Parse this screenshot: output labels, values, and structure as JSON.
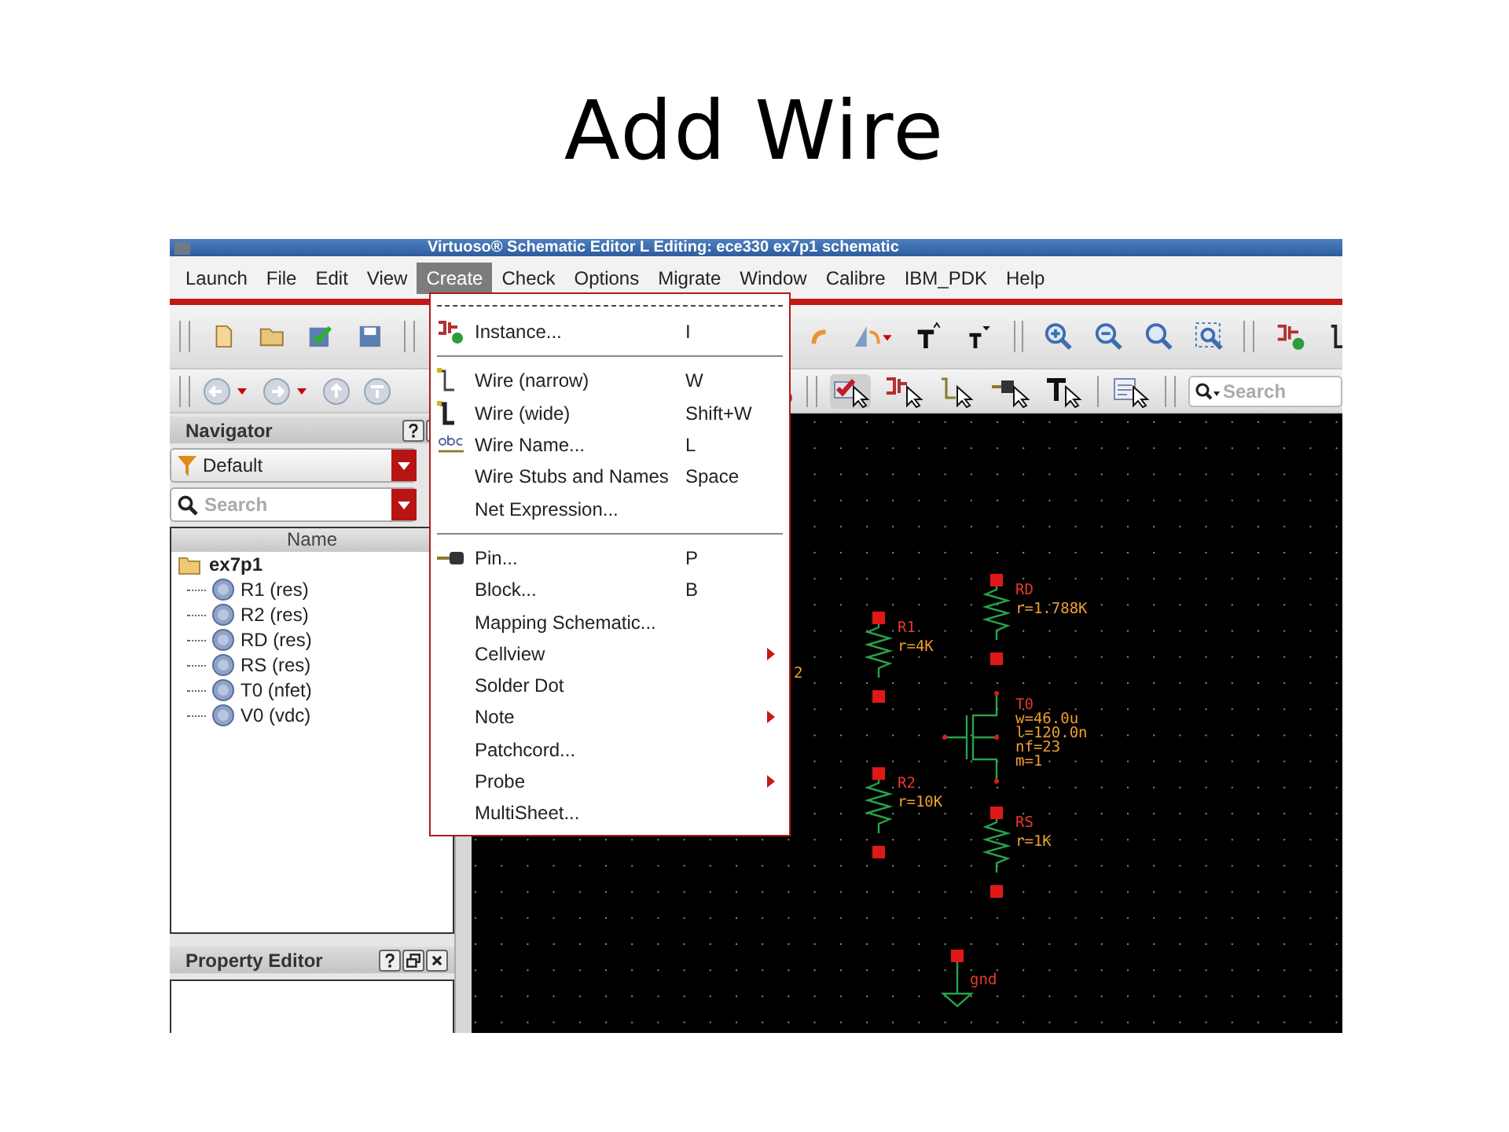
{
  "slide_title": "Add Wire",
  "window": {
    "title": "Virtuoso® Schematic Editor L Editing: ece330 ex7p1 schematic"
  },
  "menubar": [
    {
      "label": "Launch",
      "selected": false
    },
    {
      "label": "File",
      "selected": false
    },
    {
      "label": "Edit",
      "selected": false
    },
    {
      "label": "View",
      "selected": false
    },
    {
      "label": "Create",
      "selected": true
    },
    {
      "label": "Check",
      "selected": false
    },
    {
      "label": "Options",
      "selected": false
    },
    {
      "label": "Migrate",
      "selected": false
    },
    {
      "label": "Window",
      "selected": false
    },
    {
      "label": "Calibre",
      "selected": false
    },
    {
      "label": "IBM_PDK",
      "selected": false
    },
    {
      "label": "Help",
      "selected": false
    }
  ],
  "toolbar": {
    "search": {
      "placeholder": "Search"
    }
  },
  "create_menu": [
    {
      "kind": "instance",
      "label": "Instance...",
      "shortcut": "I",
      "submenu": false
    },
    {
      "kind": "separator"
    },
    {
      "kind": "wire",
      "label": "Wire (narrow)",
      "shortcut": "W",
      "submenu": false
    },
    {
      "kind": "wide-wire",
      "label": "Wire (wide)",
      "shortcut": "Shift+W",
      "submenu": false
    },
    {
      "kind": "wire-name",
      "label": "Wire Name...",
      "shortcut": "L",
      "submenu": false
    },
    {
      "kind": "plain",
      "label": "Wire Stubs and Names",
      "shortcut": "Space",
      "submenu": false
    },
    {
      "kind": "plain",
      "label": "Net Expression...",
      "submenu": false
    },
    {
      "kind": "separator"
    },
    {
      "kind": "pin",
      "label": "Pin...",
      "shortcut": "P",
      "submenu": false
    },
    {
      "kind": "plain",
      "label": "Block...",
      "shortcut": "B",
      "submenu": false
    },
    {
      "kind": "plain",
      "label": "Mapping Schematic...",
      "submenu": false
    },
    {
      "kind": "plain",
      "label": "Cellview",
      "submenu": true
    },
    {
      "kind": "plain",
      "label": "Solder Dot",
      "submenu": false
    },
    {
      "kind": "plain",
      "label": "Note",
      "submenu": true
    },
    {
      "kind": "plain",
      "label": "Patchcord...",
      "submenu": false
    },
    {
      "kind": "plain",
      "label": "Probe",
      "submenu": true
    },
    {
      "kind": "plain",
      "label": "MultiSheet...",
      "submenu": false
    }
  ],
  "navigator": {
    "title": "Navigator",
    "filter": "Default",
    "search": {
      "placeholder": "Search"
    },
    "column": "Name",
    "tree": [
      {
        "label": "ex7p1",
        "expanded": true,
        "children": [
          {
            "label": "R1 (res)"
          },
          {
            "label": "R2 (res)"
          },
          {
            "label": "RD (res)"
          },
          {
            "label": "RS (res)"
          },
          {
            "label": "T0 (nfet)"
          },
          {
            "label": "V0 (vdc)"
          }
        ]
      }
    ]
  },
  "property_editor": {
    "title": "Property Editor"
  },
  "canvas": {
    "edge_label": "2",
    "components": [
      {
        "kind": "resistor",
        "name": "RD",
        "params": [
          "r=1.788K"
        ]
      },
      {
        "kind": "resistor",
        "name": "R1",
        "params": [
          "r=4K"
        ]
      },
      {
        "kind": "nfet",
        "name": "T0",
        "params": [
          "w=46.0u",
          "l=120.0n",
          "nf=23",
          "m=1"
        ]
      },
      {
        "kind": "resistor",
        "name": "R2",
        "params": [
          "r=10K"
        ]
      },
      {
        "kind": "resistor",
        "name": "RS",
        "params": [
          "r=1K"
        ]
      },
      {
        "kind": "ground",
        "name": "gnd"
      }
    ]
  }
}
